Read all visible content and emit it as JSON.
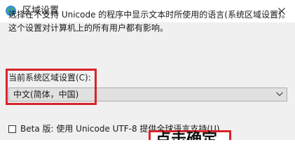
{
  "window": {
    "title": "区域设置",
    "icon": "globe-icon",
    "close_icon": "close-icon"
  },
  "description": "选择在不支持 Unicode 的程序中显示文本时所使用的语言(系统区域设置)。这个设置对计算机上的所有用户都有影响。",
  "locale": {
    "label": "当前系统区域设置(C):",
    "selected": "中文(简体，中国)"
  },
  "beta": {
    "checked": false,
    "label": "Beta 版: 使用 Unicode UTF-8 提供全球语言支持(U)"
  },
  "overlay_text": "点击确定",
  "colors": {
    "highlight": "#d8232a",
    "content_bg": "#f0f0f0"
  }
}
